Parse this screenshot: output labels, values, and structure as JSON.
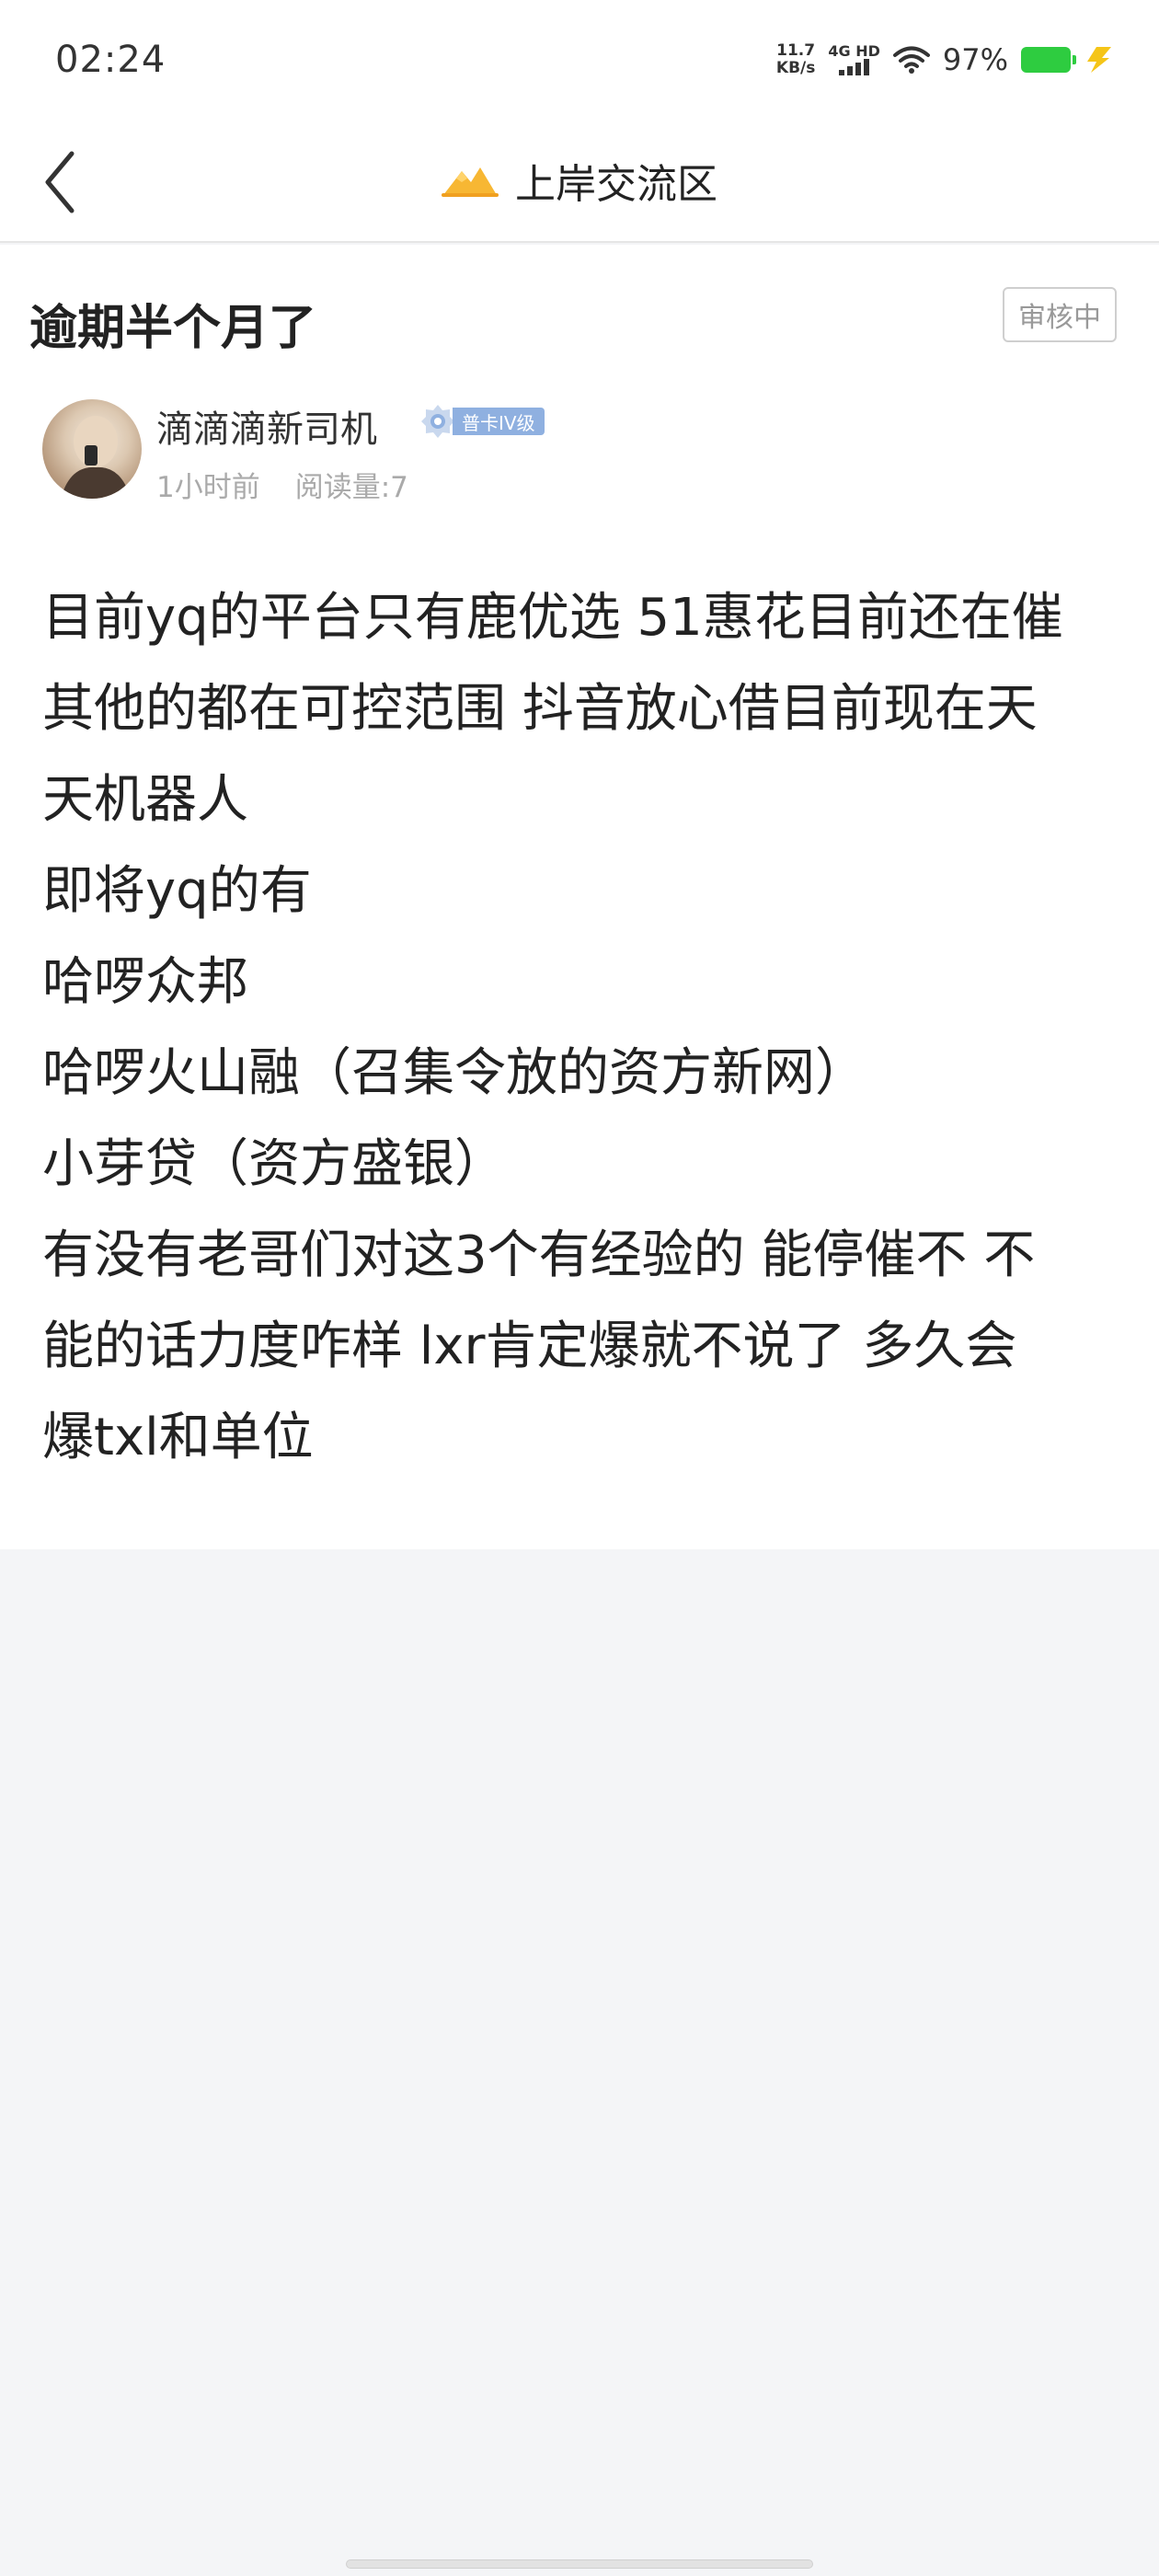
{
  "status_bar": {
    "time": "02:24",
    "net_speed_value": "11.7",
    "net_speed_unit": "KB/s",
    "signal_label": "4G HD",
    "battery_percent": "97%",
    "battery_color": "#2ecc40"
  },
  "header": {
    "title": "上岸交流区",
    "back_icon": "chevron-left-icon",
    "logo_icon": "mountain-logo-icon"
  },
  "post": {
    "title": "逾期半个月了",
    "status_badge": "审核中",
    "author": {
      "name": "滴滴滴新司机",
      "level": "普卡IV级"
    },
    "time_ago": "1小时前",
    "read_count": "阅读量:7",
    "body_lines": [
      "目前yq的平台只有鹿优选 51惠花目前还在催",
      "其他的都在可控范围 抖音放心借目前现在天",
      "天机器人",
      "即将yq的有",
      "哈啰众邦",
      "哈啰火山融（召集令放的资方新网）",
      "小芽贷（资方盛银）",
      "有没有老哥们对这3个有经验的 能停催不  不",
      "能的话力度咋样  lxr肯定爆就不说了  多久会",
      "爆txl和单位"
    ]
  }
}
